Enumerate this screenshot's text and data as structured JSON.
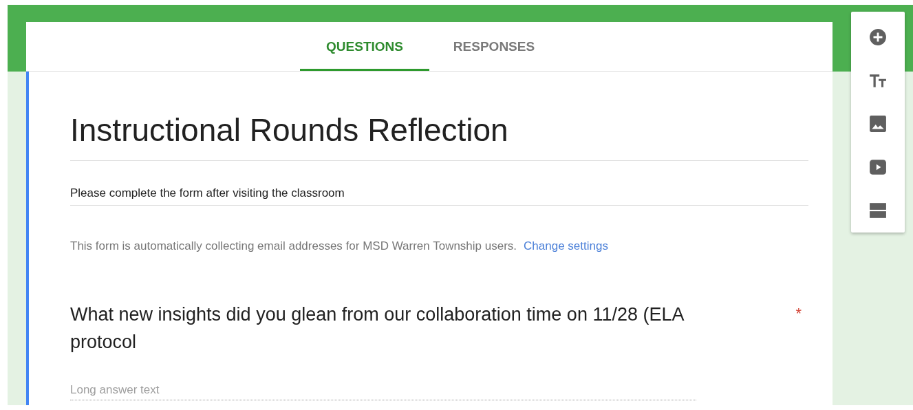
{
  "tabs": [
    {
      "label": "QUESTIONS",
      "selected": true
    },
    {
      "label": "RESPONSES",
      "selected": false
    }
  ],
  "form": {
    "title": "Instructional Rounds Reflection",
    "description": "Please complete the form after visiting the classroom",
    "notice": "This form is automatically collecting email addresses for MSD Warren Township users.",
    "notice_link": "Change settings"
  },
  "questions": [
    {
      "title": "What new insights did you glean from our collaboration time on 11/28 (ELA protocol",
      "required": true,
      "required_mark": "*",
      "kind": "long_answer",
      "placeholder": "Long answer text"
    }
  ]
}
